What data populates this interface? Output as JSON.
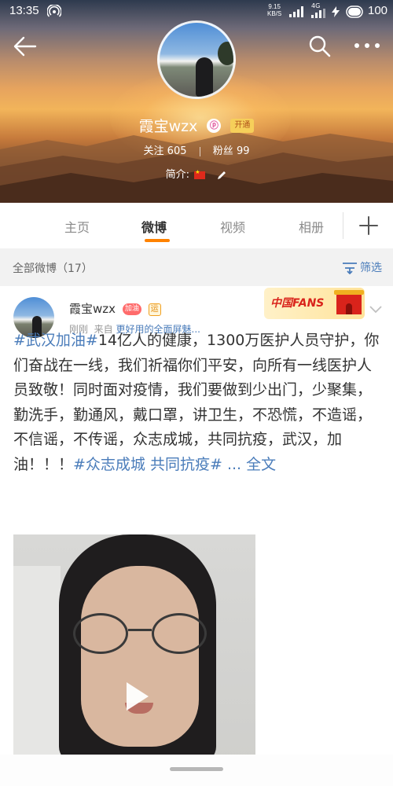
{
  "status_bar": {
    "time": "13:35",
    "speed_value": "9.15",
    "speed_unit": "KB/S",
    "network": "4G",
    "battery": "100"
  },
  "profile": {
    "name": "霞宝wzx",
    "verified_badge": "ⓟ",
    "open_badge": "开通",
    "following_label": "关注",
    "following_count": "605",
    "followers_label": "粉丝",
    "followers_count": "99",
    "intro_label": "简介:"
  },
  "tabs": {
    "items": [
      {
        "label": "主页"
      },
      {
        "label": "微博"
      },
      {
        "label": "视频"
      },
      {
        "label": "相册"
      }
    ],
    "active_index": 1
  },
  "filter": {
    "title": "全部微博（17）",
    "button": "筛选"
  },
  "post": {
    "author": "霞宝wzx",
    "heart_badge": "加油",
    "yun_badge": "运",
    "time": "刚刚",
    "from_label": "来自",
    "source": "更好用的全面屏魅...",
    "fans_badge": "中国FANS",
    "topic1": "#武汉加油#",
    "body": "14亿人的健康，1300万医护人员守护，你们奋战在一线，我们祈福你们平安，向所有一线医护人员致敬！同时面对疫情，我们要做到少出门，少聚集，勤洗手，勤通风，戴口罩，讲卫生，不恐慌，不造谣，不信谣，不传谣，众志成城，共同抗疫，武汉，加油！！！",
    "topic2": "#众志成城 共同抗疫#",
    "more": " ... 全文"
  },
  "colors": {
    "accent_orange": "#ff8200",
    "link_blue": "#4a7cba"
  },
  "icons": {
    "back": "arrow-left-icon",
    "search": "search-icon",
    "more": "more-dots-icon",
    "play": "play-icon",
    "filter": "filter-icon",
    "add": "plus-icon"
  }
}
